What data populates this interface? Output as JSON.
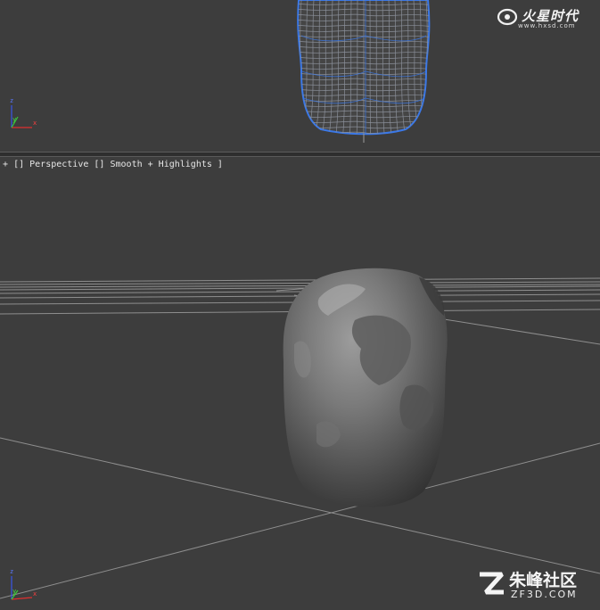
{
  "top_viewport": {
    "axis": {
      "z": "z",
      "y": "y",
      "x": "x"
    }
  },
  "perspective_viewport": {
    "label_parts": [
      "+",
      "[]",
      "Perspective",
      "[]",
      "Smooth + Highlights",
      "]"
    ],
    "axis": {
      "z": "z",
      "y": "y",
      "x": "x"
    }
  },
  "watermarks": {
    "top_brand": "火星时代",
    "top_url": "www.hxsd.com",
    "bottom_brand": "朱峰社区",
    "bottom_url": "ZF3D.COM"
  },
  "colors": {
    "viewport_bg": "#3d3d3d",
    "wireframe": "#3a78e8",
    "grid": "#9a9a9a",
    "axis_x": "#e03030",
    "axis_y": "#38c838",
    "axis_z": "#3a58e8"
  }
}
